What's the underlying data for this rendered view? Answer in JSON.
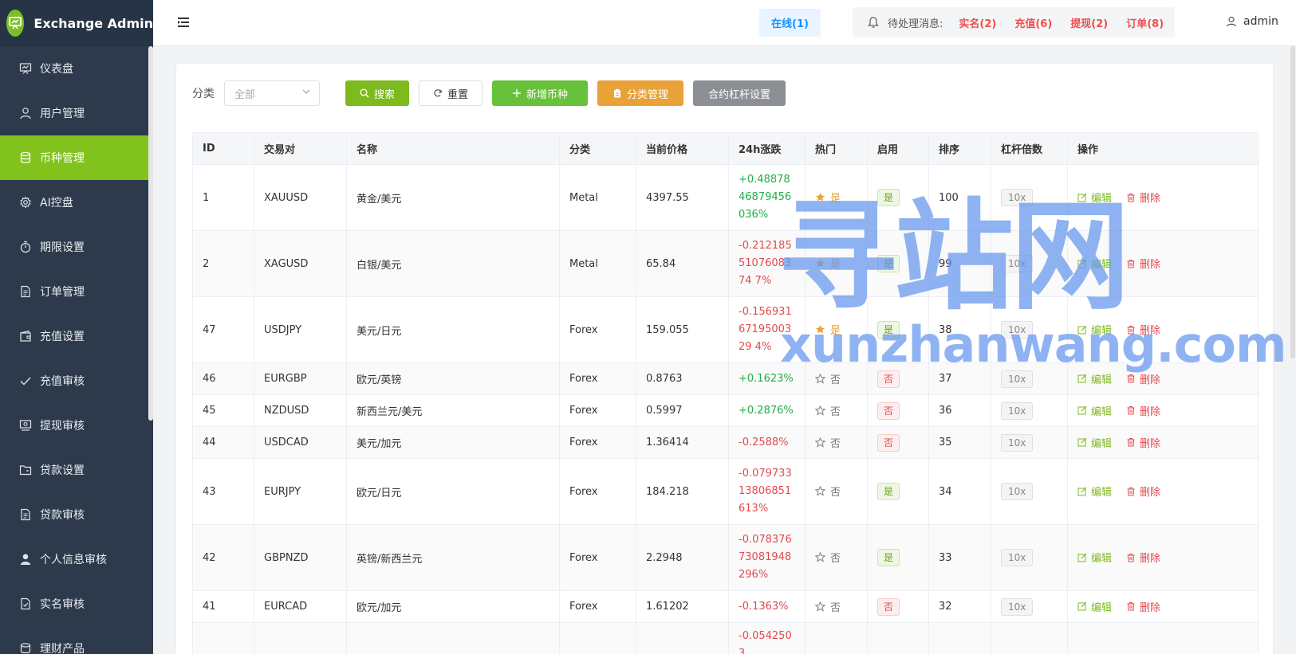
{
  "app": {
    "title": "Exchange Admin"
  },
  "sidebar": {
    "items": [
      {
        "label": "仪表盘",
        "icon": "chart-board-icon",
        "name": "dashboard"
      },
      {
        "label": "用户管理",
        "icon": "user-icon",
        "name": "users"
      },
      {
        "label": "币种管理",
        "icon": "database-icon",
        "name": "coins",
        "active": true
      },
      {
        "label": "AI控盘",
        "icon": "gear-icon",
        "name": "ai-control"
      },
      {
        "label": "期限设置",
        "icon": "timer-icon",
        "name": "term-settings"
      },
      {
        "label": "订单管理",
        "icon": "document-icon",
        "name": "orders"
      },
      {
        "label": "充值设置",
        "icon": "wallet-icon",
        "name": "recharge-settings"
      },
      {
        "label": "充值审核",
        "icon": "check-icon",
        "name": "recharge-review"
      },
      {
        "label": "提现审核",
        "icon": "money-icon",
        "name": "withdraw-review"
      },
      {
        "label": "贷款设置",
        "icon": "folder-icon",
        "name": "loan-settings"
      },
      {
        "label": "贷款审核",
        "icon": "document-icon",
        "name": "loan-review"
      },
      {
        "label": "个人信息审核",
        "icon": "person-filled-icon",
        "name": "profile-review"
      },
      {
        "label": "实名审核",
        "icon": "doc-check-icon",
        "name": "kyc-review"
      },
      {
        "label": "理财产品",
        "icon": "coins-icon",
        "name": "wealth-products"
      }
    ]
  },
  "header": {
    "online": "在线(1)",
    "pending_label": "待处理消息:",
    "pending": [
      {
        "label": "实名(2)",
        "name": "kyc"
      },
      {
        "label": "充值(6)",
        "name": "recharge"
      },
      {
        "label": "提现(2)",
        "name": "withdraw"
      },
      {
        "label": "订单(8)",
        "name": "orders"
      }
    ],
    "user": "admin"
  },
  "toolbar": {
    "filter_label": "分类",
    "select_value": "全部",
    "search": "搜索",
    "reset": "重置",
    "add": "新增币种",
    "category": "分类管理",
    "leverage": "合约杠杆设置"
  },
  "table": {
    "columns": [
      "ID",
      "交易对",
      "名称",
      "分类",
      "当前价格",
      "24h涨跌",
      "热门",
      "启用",
      "排序",
      "杠杆倍数",
      "操作"
    ],
    "edit_label": "编辑",
    "delete_label": "删除",
    "rows": [
      {
        "id": "1",
        "pair": "XAUUSD",
        "name": "黄金/美元",
        "category": "Metal",
        "price": "4397.55",
        "change": "+0.4887846879456036%",
        "dir": "up",
        "hot": "是",
        "hot_on": true,
        "enabled": "是",
        "enabled_on": true,
        "sort": "100",
        "leverage": "10x"
      },
      {
        "id": "2",
        "pair": "XAGUSD",
        "name": "白银/美元",
        "category": "Metal",
        "price": "65.84",
        "change": "-0.2121855107608374 7%",
        "dir": "down",
        "hot": "是",
        "hot_on": true,
        "enabled": "是",
        "enabled_on": true,
        "sort": "99",
        "leverage": "10x"
      },
      {
        "id": "47",
        "pair": "USDJPY",
        "name": "美元/日元",
        "category": "Forex",
        "price": "159.055",
        "change": "-0.1569316719500329 4%",
        "dir": "down",
        "hot": "是",
        "hot_on": true,
        "enabled": "是",
        "enabled_on": true,
        "sort": "38",
        "leverage": "10x"
      },
      {
        "id": "46",
        "pair": "EURGBP",
        "name": "欧元/英镑",
        "category": "Forex",
        "price": "0.8763",
        "change": "+0.1623%",
        "dir": "up",
        "hot": "否",
        "hot_on": false,
        "enabled": "否",
        "enabled_on": false,
        "sort": "37",
        "leverage": "10x"
      },
      {
        "id": "45",
        "pair": "NZDUSD",
        "name": "新西兰元/美元",
        "category": "Forex",
        "price": "0.5997",
        "change": "+0.2876%",
        "dir": "up",
        "hot": "否",
        "hot_on": false,
        "enabled": "否",
        "enabled_on": false,
        "sort": "36",
        "leverage": "10x"
      },
      {
        "id": "44",
        "pair": "USDCAD",
        "name": "美元/加元",
        "category": "Forex",
        "price": "1.36414",
        "change": "-0.2588%",
        "dir": "down",
        "hot": "否",
        "hot_on": false,
        "enabled": "否",
        "enabled_on": false,
        "sort": "35",
        "leverage": "10x"
      },
      {
        "id": "43",
        "pair": "EURJPY",
        "name": "欧元/日元",
        "category": "Forex",
        "price": "184.218",
        "change": "-0.07973313806851613%",
        "dir": "down",
        "hot": "否",
        "hot_on": false,
        "enabled": "是",
        "enabled_on": true,
        "sort": "34",
        "leverage": "10x"
      },
      {
        "id": "42",
        "pair": "GBPNZD",
        "name": "英镑/新西兰元",
        "category": "Forex",
        "price": "2.2948",
        "change": "-0.07837673081948296%",
        "dir": "down",
        "hot": "否",
        "hot_on": false,
        "enabled": "是",
        "enabled_on": true,
        "sort": "33",
        "leverage": "10x"
      },
      {
        "id": "41",
        "pair": "EURCAD",
        "name": "欧元/加元",
        "category": "Forex",
        "price": "1.61202",
        "change": "-0.1363%",
        "dir": "down",
        "hot": "否",
        "hot_on": false,
        "enabled": "否",
        "enabled_on": false,
        "sort": "32",
        "leverage": "10x"
      },
      {
        "id": "",
        "pair": "",
        "name": "",
        "category": "",
        "price": "",
        "change": "-0.0542503",
        "dir": "down",
        "hot": "",
        "hot_on": false,
        "enabled": "",
        "enabled_on": false,
        "sort": "",
        "leverage": "",
        "partial": true
      }
    ]
  },
  "watermark": {
    "big": "寻站网",
    "small": "xunzhanwang.com"
  },
  "colors": {
    "sidebar_bg": "#2d3a4b",
    "active": "#82c21d",
    "up": "#1db044",
    "down": "#e5484d",
    "warning": "#e9a237"
  }
}
